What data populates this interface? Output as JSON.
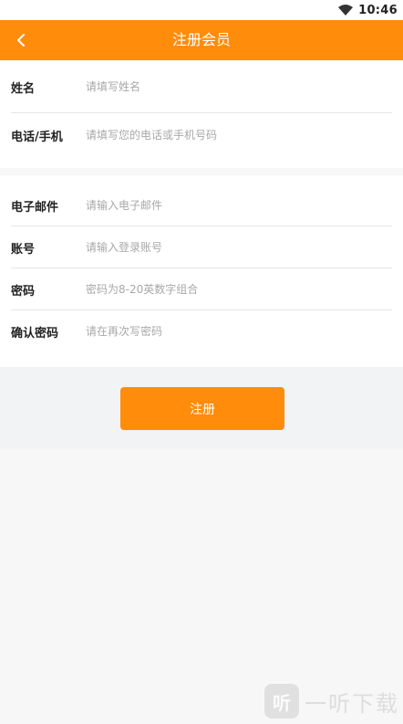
{
  "status_bar": {
    "time": "10:46",
    "wifi_icon": "wifi-icon"
  },
  "header": {
    "title": "注册会员",
    "back_icon": "chevron-left-icon",
    "background": "#ff8c0a"
  },
  "form": {
    "section1": [
      {
        "label": "姓名",
        "placeholder": "请填写姓名",
        "value": ""
      },
      {
        "label": "电话/手机",
        "placeholder": "请填写您的电话或手机号码",
        "value": ""
      }
    ],
    "section2": [
      {
        "label": "电子邮件",
        "placeholder": "请输入电子邮件",
        "value": ""
      },
      {
        "label": "账号",
        "placeholder": "请输入登录账号",
        "value": ""
      },
      {
        "label": "密码",
        "placeholder": "密码为8-20英数字组合",
        "value": ""
      },
      {
        "label": "确认密码",
        "placeholder": "请在再次写密码",
        "value": ""
      }
    ]
  },
  "submit_label": "注册",
  "watermark": {
    "logo_char": "听",
    "text": "一听下载"
  }
}
